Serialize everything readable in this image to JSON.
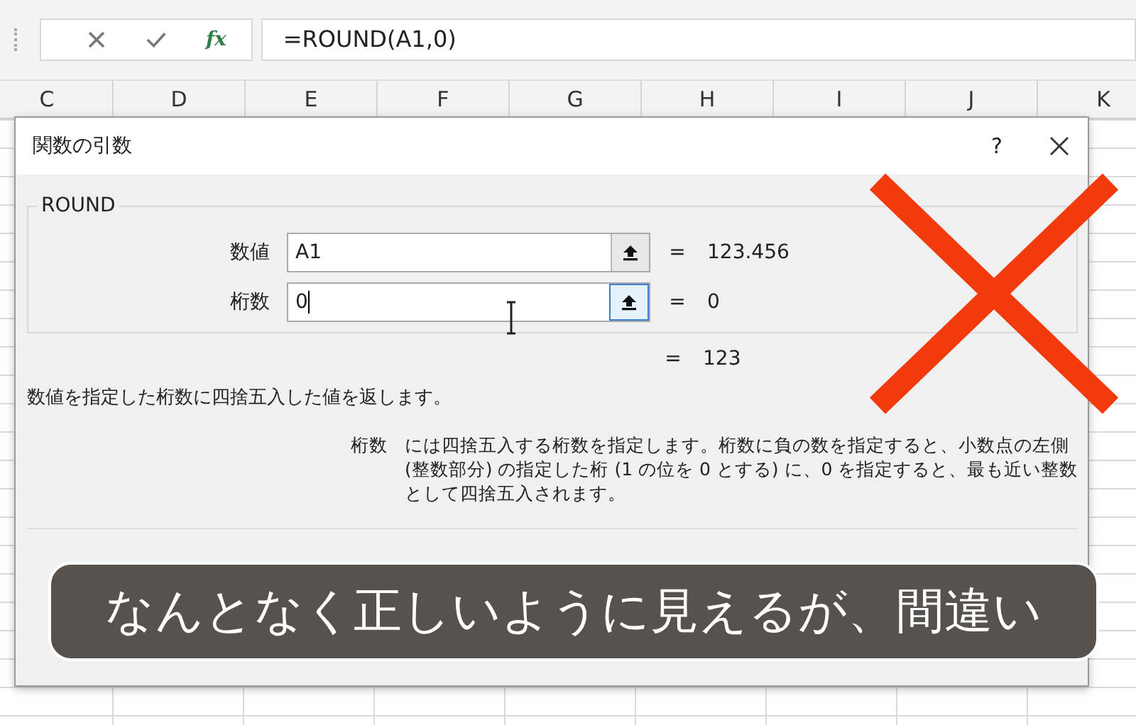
{
  "formula_bar": {
    "fx_label": "fx",
    "formula": "=ROUND(A1,0)"
  },
  "columns": [
    "C",
    "D",
    "E",
    "F",
    "G",
    "H",
    "I",
    "J",
    "K"
  ],
  "dialog": {
    "title": "関数の引数",
    "help": "?",
    "function_name": "ROUND",
    "arguments": [
      {
        "label": "数値",
        "value": "A1",
        "equals": "=",
        "result": "123.456",
        "focused": false
      },
      {
        "label": "桁数",
        "value": "0",
        "equals": "=",
        "result": "0",
        "focused": true
      }
    ],
    "total_equals": "=",
    "total_result": "123",
    "description": "数値を指定した桁数に四捨五入した値を返します。",
    "argument_help": {
      "name": "桁数",
      "text": "には四捨五入する桁数を指定します。桁数に負の数を指定すると、小数点の左側 (整数部分) の指定した桁 (1 の位を 0 とする) に、0 を指定すると、最も近い整数として四捨五入されます。"
    }
  },
  "caption": "なんとなく正しいように見えるが、間違い"
}
